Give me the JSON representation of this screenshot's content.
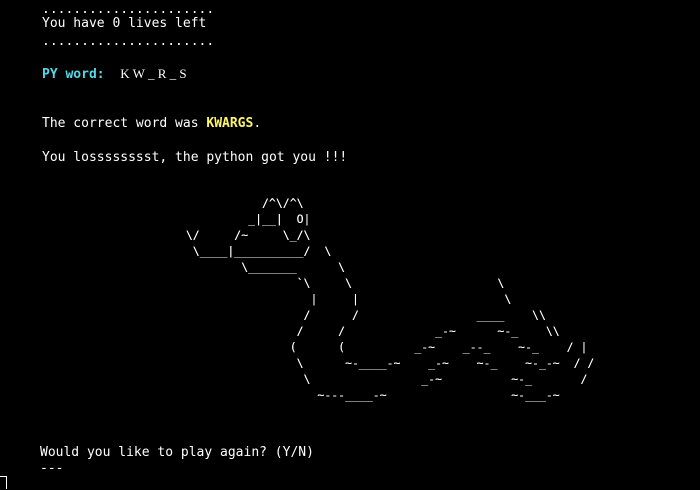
{
  "status": {
    "separator": "......................",
    "lives_text": "You have 0 lives left"
  },
  "word": {
    "label": "PY word:",
    "display": "K W _ R _ S"
  },
  "result": {
    "prefix": "The correct word was ",
    "answer": "KWARGS",
    "suffix": ".",
    "lose_text": "You losssssssst, the python got you !!!"
  },
  "art": {
    "snake": "             /^\\/^\\\n           _|__|  O|\n  \\/     /~     \\_/\\\n   \\____|__________/  \\\n          \\_______      \\\n                  `\\     \\                     \\\n                    |     |                     \\\n                   /      /                 ____    \\\\\n                  /     /             _-~      ~-_    \\\\\n                 (      (          _-~    _--_    ~-_    / |\n                  \\      ~-____-~    _-~    ~-_    ~-_-~  / /\n                   \\                _-~          ~-_       /\n                     ~---____-~                  ~-___-~"
  },
  "prompt": {
    "question": "Would you like to play again? (Y/N)",
    "input": "---"
  }
}
